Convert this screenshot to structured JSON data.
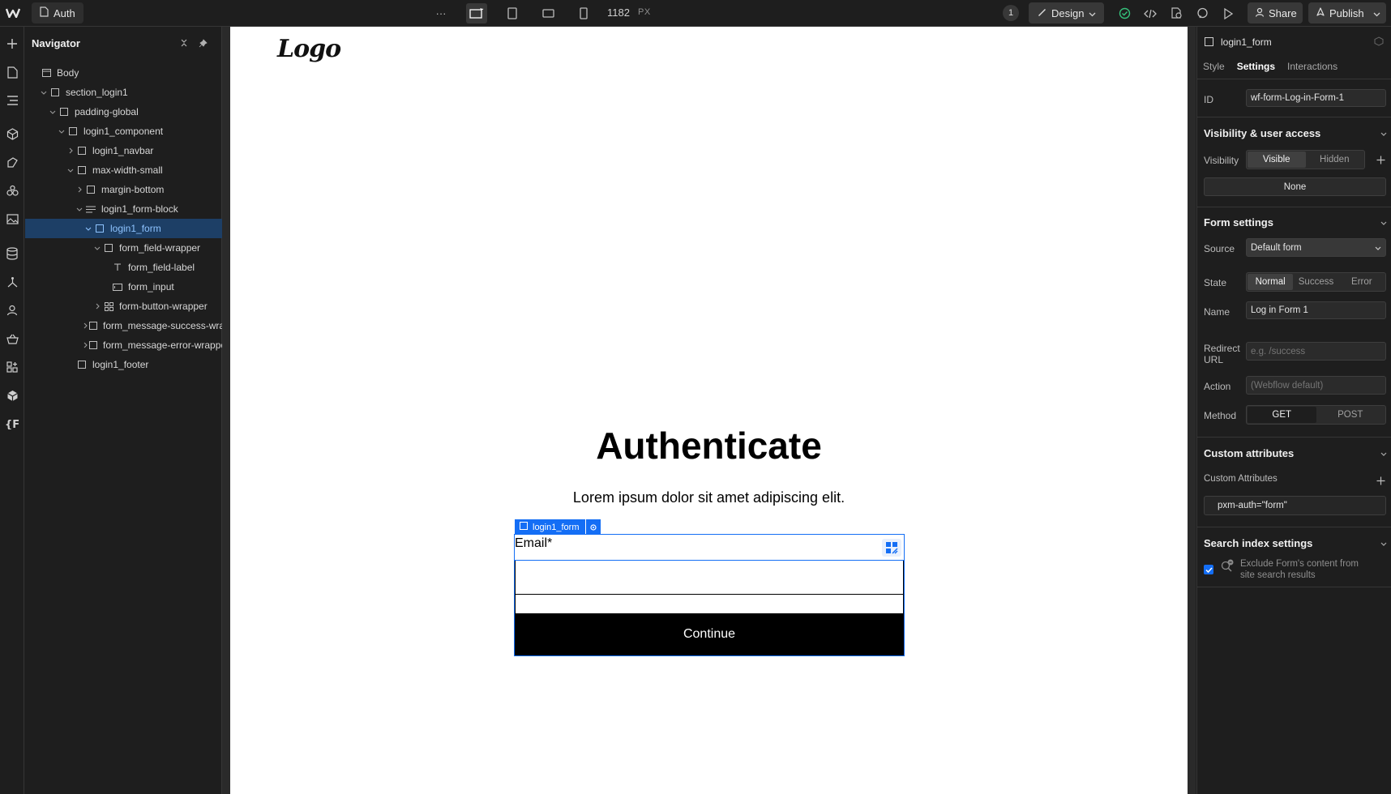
{
  "topbar": {
    "page_name": "Auth",
    "more_label": "···",
    "canvas_width": "1182",
    "canvas_unit": "PX",
    "collaborators_count": "1",
    "mode_label": "Design",
    "share_label": "Share",
    "publish_label": "Publish"
  },
  "navigator": {
    "title": "Navigator",
    "items": [
      {
        "label": "Body"
      },
      {
        "label": "section_login1"
      },
      {
        "label": "padding-global"
      },
      {
        "label": "login1_component"
      },
      {
        "label": "login1_navbar"
      },
      {
        "label": "max-width-small"
      },
      {
        "label": "margin-bottom"
      },
      {
        "label": "login1_form-block"
      },
      {
        "label": "login1_form"
      },
      {
        "label": "form_field-wrapper"
      },
      {
        "label": "form_field-label"
      },
      {
        "label": "form_input"
      },
      {
        "label": "form-button-wrapper"
      },
      {
        "label": "form_message-success-wrapper"
      },
      {
        "label": "form_message-error-wrapper"
      },
      {
        "label": "login1_footer"
      }
    ]
  },
  "canvas": {
    "logo_text": "Logo",
    "heading": "Authenticate",
    "subheading": "Lorem ipsum dolor sit amet adipiscing elit.",
    "form_tag": "login1_form",
    "email_label": "Email*",
    "button_label": "Continue"
  },
  "panel": {
    "selected_element": "login1_form",
    "tabs": [
      "Style",
      "Settings",
      "Interactions"
    ],
    "active_tab": "Settings",
    "id_label": "ID",
    "id_value": "wf-form-Log-in-Form-1",
    "visibility_section": "Visibility & user access",
    "visibility_label": "Visibility",
    "visibility_options": [
      "Visible",
      "Hidden"
    ],
    "access_value": "None",
    "form_settings_section": "Form settings",
    "source_label": "Source",
    "source_value": "Default form",
    "state_label": "State",
    "state_options": [
      "Normal",
      "Success",
      "Error"
    ],
    "name_label": "Name",
    "name_value": "Log in Form 1",
    "redirect_label_1": "Redirect",
    "redirect_label_2": "URL",
    "redirect_placeholder": "e.g. /success",
    "action_label": "Action",
    "action_placeholder": "(Webflow default)",
    "method_label": "Method",
    "method_options": [
      "GET",
      "POST"
    ],
    "custom_attr_section": "Custom attributes",
    "custom_attr_label": "Custom Attributes",
    "custom_attr_value": "pxm-auth=\"form\"",
    "search_section": "Search index settings",
    "search_checkbox_label_1": "Exclude Form's content from",
    "search_checkbox_label_2": "site search results"
  },
  "colors": {
    "accent": "#146ef5",
    "selected_row": "#1d3f66",
    "ui_background": "#1e1e1e"
  }
}
